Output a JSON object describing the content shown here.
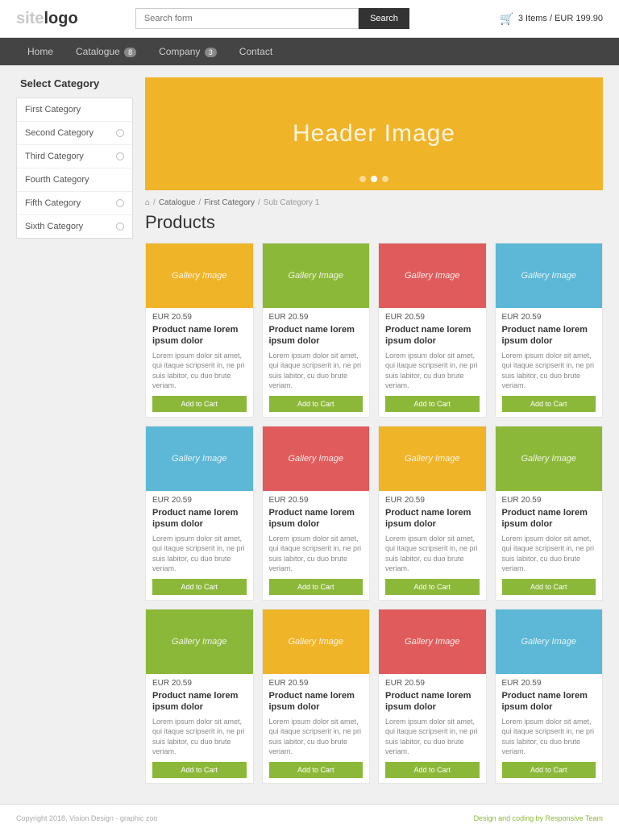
{
  "header": {
    "logo_text": "site",
    "logo_accent": "logo",
    "search_placeholder": "Search form",
    "search_button": "Search",
    "cart_icon": "🛒",
    "cart_info": "3 Items / EUR 199.90"
  },
  "nav": {
    "items": [
      {
        "label": "Home",
        "badge": null
      },
      {
        "label": "Catalogue",
        "badge": "8"
      },
      {
        "label": "Company",
        "badge": "3"
      },
      {
        "label": "Contact",
        "badge": null
      }
    ]
  },
  "sidebar": {
    "title": "Select Category",
    "items": [
      {
        "label": "First Category",
        "has_dot": false
      },
      {
        "label": "Second Category",
        "has_dot": true
      },
      {
        "label": "Third Category",
        "has_dot": true
      },
      {
        "label": "Fourth Category",
        "has_dot": false
      },
      {
        "label": "Fifth Category",
        "has_dot": true
      },
      {
        "label": "Sixth Category",
        "has_dot": true
      }
    ]
  },
  "hero": {
    "title": "Header Image",
    "dots": [
      false,
      true,
      false
    ]
  },
  "breadcrumb": {
    "home": "⌂",
    "catalogue": "Catalogue",
    "first_category": "First Category",
    "sub_category": "Sub Category 1"
  },
  "products": {
    "section_title": "Products",
    "items": [
      {
        "image_label": "Gallery Image",
        "image_color": "yellow",
        "price": "EUR 20.59",
        "name": "Product name lorem ipsum dolor",
        "desc": "Lorem ipsum dolor sit amet, qui itaque scripserit in, ne pri suis labitor, cu duo brute veriam.",
        "button": "Add to Cart"
      },
      {
        "image_label": "Gallery Image",
        "image_color": "green",
        "price": "EUR 20.59",
        "name": "Product name lorem ipsum dolor",
        "desc": "Lorem ipsum dolor sit amet, qui itaque scripserit in, ne pri suis labitor, cu duo brute veriam.",
        "button": "Add to Cart"
      },
      {
        "image_label": "Gallery Image",
        "image_color": "red",
        "price": "EUR 20.59",
        "name": "Product name lorem ipsum dolor",
        "desc": "Lorem ipsum dolor sit amet, qui itaque scripserit in, ne pri suis labitor, cu duo brute veriam.",
        "button": "Add to Cart"
      },
      {
        "image_label": "Gallery Image",
        "image_color": "blue",
        "price": "EUR 20.59",
        "name": "Product name lorem ipsum dolor",
        "desc": "Lorem ipsum dolor sit amet, qui itaque scripserit in, ne pri suis labitor, cu duo brute veriam.",
        "button": "Add to Cart"
      },
      {
        "image_label": "Gallery Image",
        "image_color": "blue",
        "price": "EUR 20.59",
        "name": "Product name lorem ipsum dolor",
        "desc": "Lorem ipsum dolor sit amet, qui itaque scripserit in, ne pri suis labitor, cu duo brute veriam.",
        "button": "Add to Cart"
      },
      {
        "image_label": "Gallery Image",
        "image_color": "red",
        "price": "EUR 20.59",
        "name": "Product name lorem ipsum dolor",
        "desc": "Lorem ipsum dolor sit amet, qui itaque scripserit in, ne pri suis labitor, cu duo brute veriam.",
        "button": "Add to Cart"
      },
      {
        "image_label": "Gallery Image",
        "image_color": "yellow",
        "price": "EUR 20.59",
        "name": "Product name lorem ipsum dolor",
        "desc": "Lorem ipsum dolor sit amet, qui itaque scripserit in, ne pri suis labitor, cu duo brute veriam.",
        "button": "Add to Cart"
      },
      {
        "image_label": "Gallery Image",
        "image_color": "green",
        "price": "EUR 20.59",
        "name": "Product name lorem ipsum dolor",
        "desc": "Lorem ipsum dolor sit amet, qui itaque scripserit in, ne pri suis labitor, cu duo brute veriam.",
        "button": "Add to Cart"
      },
      {
        "image_label": "Gallery Image",
        "image_color": "green",
        "price": "EUR 20.59",
        "name": "Product name lorem ipsum dolor",
        "desc": "Lorem ipsum dolor sit amet, qui itaque scripserit in, ne pri suis labitor, cu duo brute veriam.",
        "button": "Add to Cart"
      },
      {
        "image_label": "Gallery Image",
        "image_color": "yellow",
        "price": "EUR 20.59",
        "name": "Product name lorem ipsum dolor",
        "desc": "Lorem ipsum dolor sit amet, qui itaque scripserit in, ne pri suis labitor, cu duo brute veriam.",
        "button": "Add to Cart"
      },
      {
        "image_label": "Gallery Image",
        "image_color": "red",
        "price": "EUR 20.59",
        "name": "Product name lorem ipsum dolor",
        "desc": "Lorem ipsum dolor sit amet, qui itaque scripserit in, ne pri suis labitor, cu duo brute veriam.",
        "button": "Add to Cart"
      },
      {
        "image_label": "Gallery Image",
        "image_color": "blue",
        "price": "EUR 20.59",
        "name": "Product name lorem ipsum dolor",
        "desc": "Lorem ipsum dolor sit amet, qui itaque scripserit in, ne pri suis labitor, cu duo brute veriam.",
        "button": "Add to Cart"
      }
    ]
  },
  "footer": {
    "left": "Copyright 2018, Vision Design - graphic zoo",
    "right": "Design and coding by Responsive Team"
  }
}
